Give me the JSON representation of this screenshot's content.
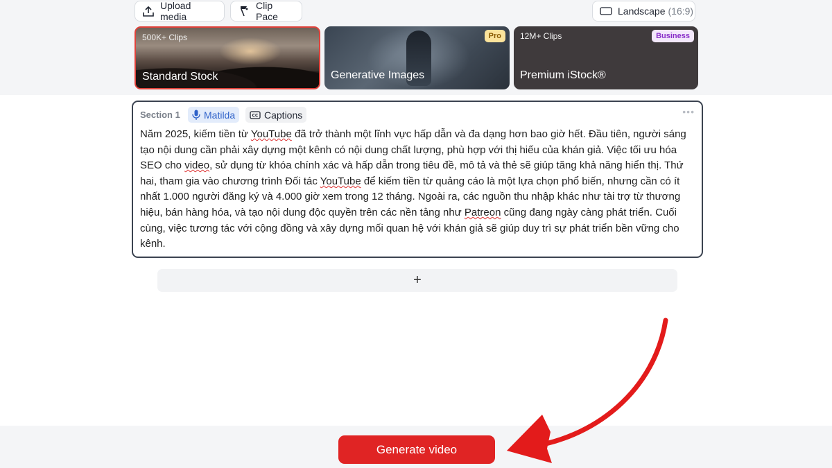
{
  "toolbar": {
    "upload_label": "Upload media",
    "clip_pace_label": "Clip Pace",
    "aspect_label": "Landscape",
    "aspect_ratio": "(16:9)"
  },
  "stock_cards": [
    {
      "clips": "500K+ Clips",
      "title": "Standard Stock",
      "badge": "",
      "selected": true
    },
    {
      "clips": "",
      "title": "Generative Images",
      "badge": "Pro",
      "selected": false
    },
    {
      "clips": "12M+ Clips",
      "title": "Premium iStock®",
      "badge": "Business",
      "selected": false
    }
  ],
  "section": {
    "label": "Section 1",
    "voice_label": "Matilda",
    "captions_label": "Captions",
    "more_icon": "•••",
    "text": "Năm 2025, kiếm tiền từ YouTube đã trở thành một lĩnh vực hấp dẫn và đa dạng hơn bao giờ hết. Đầu tiên, người sáng tạo nội dung cần phải xây dựng một kênh có nội dung chất lượng, phù hợp với thị hiếu của khán giả. Việc tối ưu hóa SEO cho video, sử dụng từ khóa chính xác và hấp dẫn trong tiêu đề, mô tả và thẻ sẽ giúp tăng khả năng hiển thị. Thứ hai, tham gia vào chương trình Đối tác YouTube để kiếm tiền từ quảng cáo là một lựa chọn phổ biến, nhưng cần có ít nhất 1.000 người đăng ký và 4.000 giờ xem trong 12 tháng. Ngoài ra, các nguồn thu nhập khác như tài trợ từ thương hiệu, bán hàng hóa, và tạo nội dung độc quyền trên các nền tảng như Patreon cũng đang ngày càng phát triển. Cuối cùng, việc tương tác với cộng đồng và xây dựng mối quan hệ với khán giả sẽ giúp duy trì sự phát triển bền vững cho kênh."
  },
  "add_section": {
    "label": "+"
  },
  "footer": {
    "generate_label": "Generate video"
  },
  "colors": {
    "accent_red": "#e02424",
    "voice_chip_bg": "#e3ecfb",
    "pro_badge_bg": "#fbe39b",
    "business_badge_bg": "#f3e8fb",
    "business_badge_text": "#8a2fc9"
  },
  "icons": {
    "upload": "upload-icon",
    "clip_pace": "clip-pace-icon",
    "landscape": "landscape-icon",
    "microphone": "microphone-icon",
    "captions": "captions-icon",
    "annotation_arrow": "red-arrow"
  }
}
